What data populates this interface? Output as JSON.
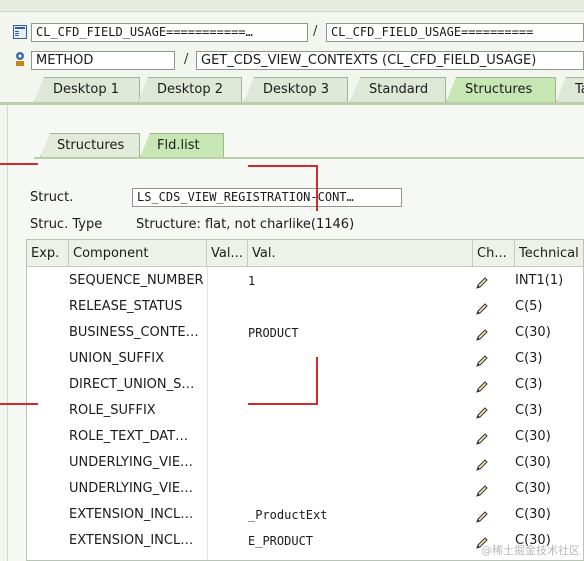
{
  "header": {
    "path_field_1": "CL_CFD_FIELD_USAGE===========…",
    "path_separator_1": "/",
    "path_field_2": "CL_CFD_FIELD_USAGE==========",
    "type_field": "METHOD",
    "path_separator_2": "/",
    "method_field": "GET_CDS_VIEW_CONTEXTS (CL_CFD_FIELD_USAGE)"
  },
  "tabs": [
    {
      "label": "Desktop 1"
    },
    {
      "label": "Desktop 2"
    },
    {
      "label": "Desktop 3"
    },
    {
      "label": "Standard"
    },
    {
      "label": "Structures"
    },
    {
      "label": "Ta"
    }
  ],
  "subtabs": [
    {
      "label": "Structures"
    },
    {
      "label": "Fld.list"
    }
  ],
  "struct": {
    "label": "Struct.",
    "value": "LS_CDS_VIEW_REGISTRATION-CONT…",
    "type_label": "Struc. Type",
    "type_value": "Structure: flat, not charlike(1146)"
  },
  "grid": {
    "columns": [
      "Exp.",
      "Component",
      "Val...",
      "Val.",
      "Ch...",
      "Technical"
    ],
    "rows": [
      {
        "component": "SEQUENCE_NUMBER",
        "value": "1",
        "technical": "INT1(1)"
      },
      {
        "component": "RELEASE_STATUS",
        "value": "",
        "technical": "C(5)"
      },
      {
        "component": "BUSINESS_CONTE…",
        "value": "PRODUCT",
        "technical": "C(30)"
      },
      {
        "component": "UNION_SUFFIX",
        "value": "",
        "technical": "C(3)"
      },
      {
        "component": "DIRECT_UNION_S…",
        "value": "",
        "technical": "C(3)"
      },
      {
        "component": "ROLE_SUFFIX",
        "value": "",
        "technical": "C(3)"
      },
      {
        "component": "ROLE_TEXT_DAT…",
        "value": "",
        "technical": "C(30)"
      },
      {
        "component": "UNDERLYING_VIE…",
        "value": "",
        "technical": "C(30)"
      },
      {
        "component": "UNDERLYING_VIE…",
        "value": "",
        "technical": "C(30)"
      },
      {
        "component": "EXTENSION_INCL…",
        "value": "_ProductExt",
        "technical": "C(30)"
      },
      {
        "component": "EXTENSION_INCL…",
        "value": "E_PRODUCT",
        "technical": "C(30)"
      }
    ]
  },
  "icons": {
    "doc": "document-icon",
    "method": "method-gear-icon",
    "edit": "pencil-icon"
  },
  "colors": {
    "active_tab": "#c6e7b3",
    "annotation_red": "#d12a2a"
  },
  "watermark": "@稀土掘金技术社区"
}
